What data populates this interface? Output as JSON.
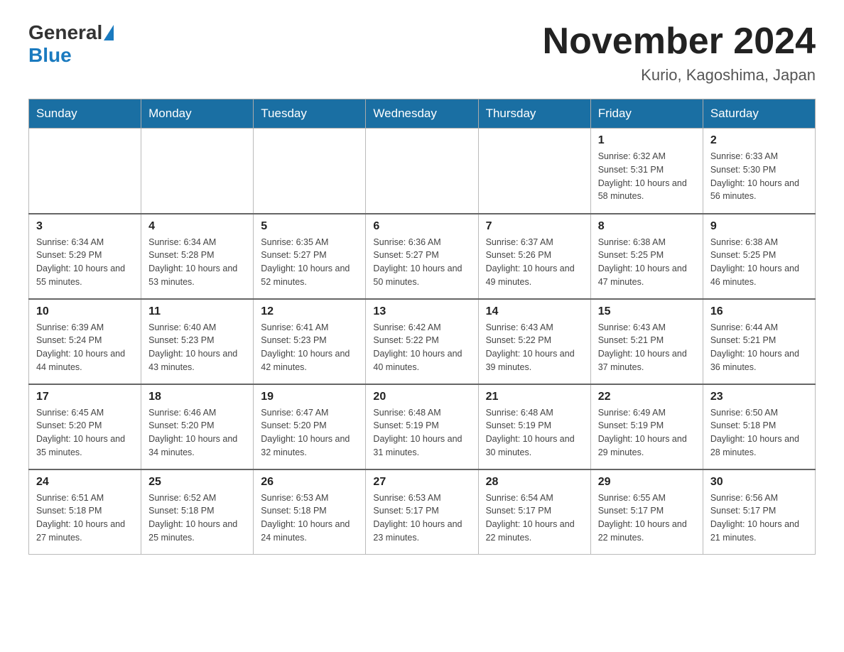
{
  "header": {
    "logo_general": "General",
    "logo_blue": "Blue",
    "month_title": "November 2024",
    "location": "Kurio, Kagoshima, Japan"
  },
  "weekdays": [
    "Sunday",
    "Monday",
    "Tuesday",
    "Wednesday",
    "Thursday",
    "Friday",
    "Saturday"
  ],
  "weeks": [
    [
      {
        "day": "",
        "sunrise": "",
        "sunset": "",
        "daylight": ""
      },
      {
        "day": "",
        "sunrise": "",
        "sunset": "",
        "daylight": ""
      },
      {
        "day": "",
        "sunrise": "",
        "sunset": "",
        "daylight": ""
      },
      {
        "day": "",
        "sunrise": "",
        "sunset": "",
        "daylight": ""
      },
      {
        "day": "",
        "sunrise": "",
        "sunset": "",
        "daylight": ""
      },
      {
        "day": "1",
        "sunrise": "Sunrise: 6:32 AM",
        "sunset": "Sunset: 5:31 PM",
        "daylight": "Daylight: 10 hours and 58 minutes."
      },
      {
        "day": "2",
        "sunrise": "Sunrise: 6:33 AM",
        "sunset": "Sunset: 5:30 PM",
        "daylight": "Daylight: 10 hours and 56 minutes."
      }
    ],
    [
      {
        "day": "3",
        "sunrise": "Sunrise: 6:34 AM",
        "sunset": "Sunset: 5:29 PM",
        "daylight": "Daylight: 10 hours and 55 minutes."
      },
      {
        "day": "4",
        "sunrise": "Sunrise: 6:34 AM",
        "sunset": "Sunset: 5:28 PM",
        "daylight": "Daylight: 10 hours and 53 minutes."
      },
      {
        "day": "5",
        "sunrise": "Sunrise: 6:35 AM",
        "sunset": "Sunset: 5:27 PM",
        "daylight": "Daylight: 10 hours and 52 minutes."
      },
      {
        "day": "6",
        "sunrise": "Sunrise: 6:36 AM",
        "sunset": "Sunset: 5:27 PM",
        "daylight": "Daylight: 10 hours and 50 minutes."
      },
      {
        "day": "7",
        "sunrise": "Sunrise: 6:37 AM",
        "sunset": "Sunset: 5:26 PM",
        "daylight": "Daylight: 10 hours and 49 minutes."
      },
      {
        "day": "8",
        "sunrise": "Sunrise: 6:38 AM",
        "sunset": "Sunset: 5:25 PM",
        "daylight": "Daylight: 10 hours and 47 minutes."
      },
      {
        "day": "9",
        "sunrise": "Sunrise: 6:38 AM",
        "sunset": "Sunset: 5:25 PM",
        "daylight": "Daylight: 10 hours and 46 minutes."
      }
    ],
    [
      {
        "day": "10",
        "sunrise": "Sunrise: 6:39 AM",
        "sunset": "Sunset: 5:24 PM",
        "daylight": "Daylight: 10 hours and 44 minutes."
      },
      {
        "day": "11",
        "sunrise": "Sunrise: 6:40 AM",
        "sunset": "Sunset: 5:23 PM",
        "daylight": "Daylight: 10 hours and 43 minutes."
      },
      {
        "day": "12",
        "sunrise": "Sunrise: 6:41 AM",
        "sunset": "Sunset: 5:23 PM",
        "daylight": "Daylight: 10 hours and 42 minutes."
      },
      {
        "day": "13",
        "sunrise": "Sunrise: 6:42 AM",
        "sunset": "Sunset: 5:22 PM",
        "daylight": "Daylight: 10 hours and 40 minutes."
      },
      {
        "day": "14",
        "sunrise": "Sunrise: 6:43 AM",
        "sunset": "Sunset: 5:22 PM",
        "daylight": "Daylight: 10 hours and 39 minutes."
      },
      {
        "day": "15",
        "sunrise": "Sunrise: 6:43 AM",
        "sunset": "Sunset: 5:21 PM",
        "daylight": "Daylight: 10 hours and 37 minutes."
      },
      {
        "day": "16",
        "sunrise": "Sunrise: 6:44 AM",
        "sunset": "Sunset: 5:21 PM",
        "daylight": "Daylight: 10 hours and 36 minutes."
      }
    ],
    [
      {
        "day": "17",
        "sunrise": "Sunrise: 6:45 AM",
        "sunset": "Sunset: 5:20 PM",
        "daylight": "Daylight: 10 hours and 35 minutes."
      },
      {
        "day": "18",
        "sunrise": "Sunrise: 6:46 AM",
        "sunset": "Sunset: 5:20 PM",
        "daylight": "Daylight: 10 hours and 34 minutes."
      },
      {
        "day": "19",
        "sunrise": "Sunrise: 6:47 AM",
        "sunset": "Sunset: 5:20 PM",
        "daylight": "Daylight: 10 hours and 32 minutes."
      },
      {
        "day": "20",
        "sunrise": "Sunrise: 6:48 AM",
        "sunset": "Sunset: 5:19 PM",
        "daylight": "Daylight: 10 hours and 31 minutes."
      },
      {
        "day": "21",
        "sunrise": "Sunrise: 6:48 AM",
        "sunset": "Sunset: 5:19 PM",
        "daylight": "Daylight: 10 hours and 30 minutes."
      },
      {
        "day": "22",
        "sunrise": "Sunrise: 6:49 AM",
        "sunset": "Sunset: 5:19 PM",
        "daylight": "Daylight: 10 hours and 29 minutes."
      },
      {
        "day": "23",
        "sunrise": "Sunrise: 6:50 AM",
        "sunset": "Sunset: 5:18 PM",
        "daylight": "Daylight: 10 hours and 28 minutes."
      }
    ],
    [
      {
        "day": "24",
        "sunrise": "Sunrise: 6:51 AM",
        "sunset": "Sunset: 5:18 PM",
        "daylight": "Daylight: 10 hours and 27 minutes."
      },
      {
        "day": "25",
        "sunrise": "Sunrise: 6:52 AM",
        "sunset": "Sunset: 5:18 PM",
        "daylight": "Daylight: 10 hours and 25 minutes."
      },
      {
        "day": "26",
        "sunrise": "Sunrise: 6:53 AM",
        "sunset": "Sunset: 5:18 PM",
        "daylight": "Daylight: 10 hours and 24 minutes."
      },
      {
        "day": "27",
        "sunrise": "Sunrise: 6:53 AM",
        "sunset": "Sunset: 5:17 PM",
        "daylight": "Daylight: 10 hours and 23 minutes."
      },
      {
        "day": "28",
        "sunrise": "Sunrise: 6:54 AM",
        "sunset": "Sunset: 5:17 PM",
        "daylight": "Daylight: 10 hours and 22 minutes."
      },
      {
        "day": "29",
        "sunrise": "Sunrise: 6:55 AM",
        "sunset": "Sunset: 5:17 PM",
        "daylight": "Daylight: 10 hours and 22 minutes."
      },
      {
        "day": "30",
        "sunrise": "Sunrise: 6:56 AM",
        "sunset": "Sunset: 5:17 PM",
        "daylight": "Daylight: 10 hours and 21 minutes."
      }
    ]
  ]
}
